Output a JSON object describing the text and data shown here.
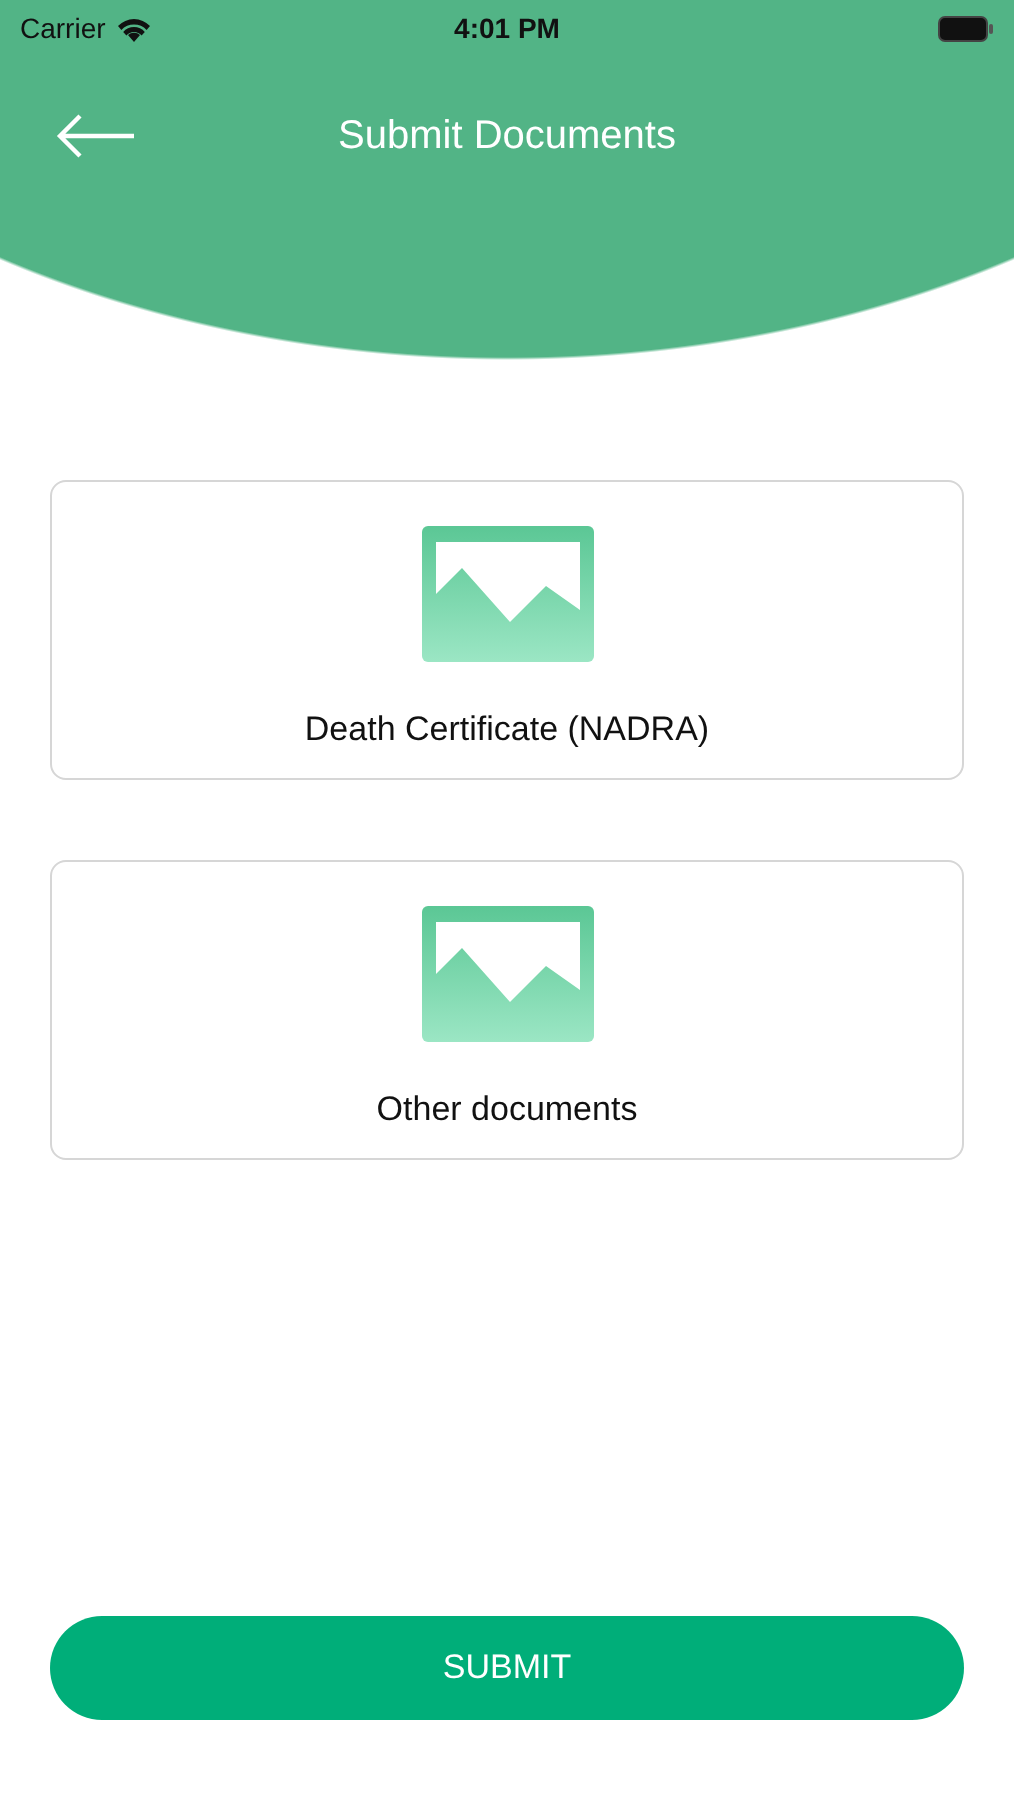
{
  "status_bar": {
    "carrier": "Carrier",
    "time": "4:01 PM"
  },
  "header": {
    "title": "Submit Documents"
  },
  "documents": [
    {
      "label": "Death Certificate (NADRA)"
    },
    {
      "label": "Other documents"
    }
  ],
  "submit": {
    "label": "SUBMIT"
  }
}
